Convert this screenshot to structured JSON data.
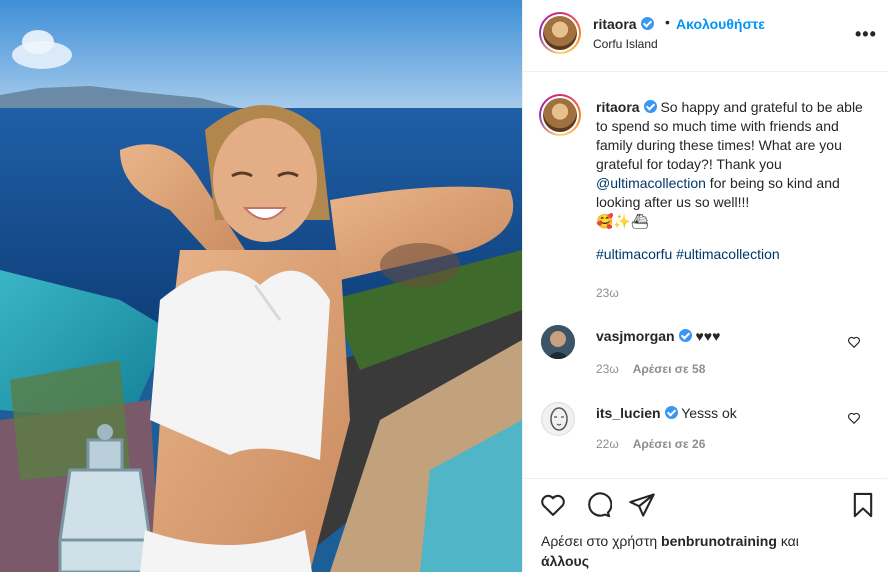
{
  "post": {
    "username": "ritaora",
    "separator": "•",
    "follow_label": "Ακολουθήστε",
    "location": "Corfu Island",
    "more_label": "•••"
  },
  "caption": {
    "username": "ritaora",
    "text_1": "So happy and grateful to be able to spend so much time with friends and family during these times! What are you grateful for today?! Thank you ",
    "mention": "@ultimacollection",
    "text_2": " for being so kind and looking after us so well!!!",
    "emojis": "🥰✨⛴",
    "hashtag_1": "#ultimacorfu",
    "hashtag_2": "#ultimacollection",
    "time": "23ω"
  },
  "comments": [
    {
      "username": "vasjmorgan",
      "text": "♥♥♥",
      "time": "23ω",
      "likes": "Αρέσει σε 58"
    },
    {
      "username": "its_lucien",
      "text": "Yesss ok",
      "time": "22ω",
      "likes": "Αρέσει σε 26"
    }
  ],
  "likes": {
    "prefix": "Αρέσει στο χρήστη",
    "user": "benbrunotraining",
    "suffix": "και",
    "line2": "άλλους"
  },
  "icons": [
    "heart-icon",
    "comment-icon",
    "share-icon",
    "bookmark-icon",
    "more-icon",
    "verified-icon"
  ],
  "colors": {
    "accent": "#0095f6",
    "verified": "#3897f0",
    "muted": "#8e8e8e",
    "text": "#262626"
  }
}
